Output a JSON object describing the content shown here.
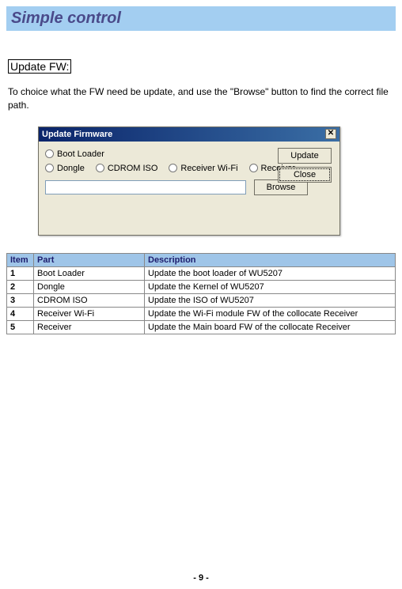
{
  "header": {
    "title": "Simple control"
  },
  "section": {
    "title": "Update FW:"
  },
  "body_text": "To choice what the FW need be update, and use the \"Browse\" button to find the correct file path.",
  "dialog": {
    "title": "Update Firmware",
    "close_glyph": "✕",
    "radios": {
      "boot_loader": "Boot Loader",
      "dongle": "Dongle",
      "cdrom_iso": "CDROM ISO",
      "receiver_wifi": "Receiver Wi-Fi",
      "receiver": "Receiver"
    },
    "file_value": "",
    "buttons": {
      "update": "Update",
      "close": "Close",
      "browse": "Browse"
    }
  },
  "table": {
    "headers": {
      "item": "Item",
      "part": "Part",
      "description": "Description"
    },
    "rows": [
      {
        "item": "1",
        "part": "Boot Loader",
        "desc": "Update the boot loader of WU5207"
      },
      {
        "item": "2",
        "part": "Dongle",
        "desc": "Update the Kernel of WU5207"
      },
      {
        "item": "3",
        "part": "CDROM ISO",
        "desc": "Update the ISO of WU5207"
      },
      {
        "item": "4",
        "part": "Receiver Wi-Fi",
        "desc": "Update the Wi-Fi module FW of the collocate Receiver"
      },
      {
        "item": "5",
        "part": "Receiver",
        "desc": "Update the Main board FW of the collocate Receiver"
      }
    ]
  },
  "page_number": "- 9 -"
}
